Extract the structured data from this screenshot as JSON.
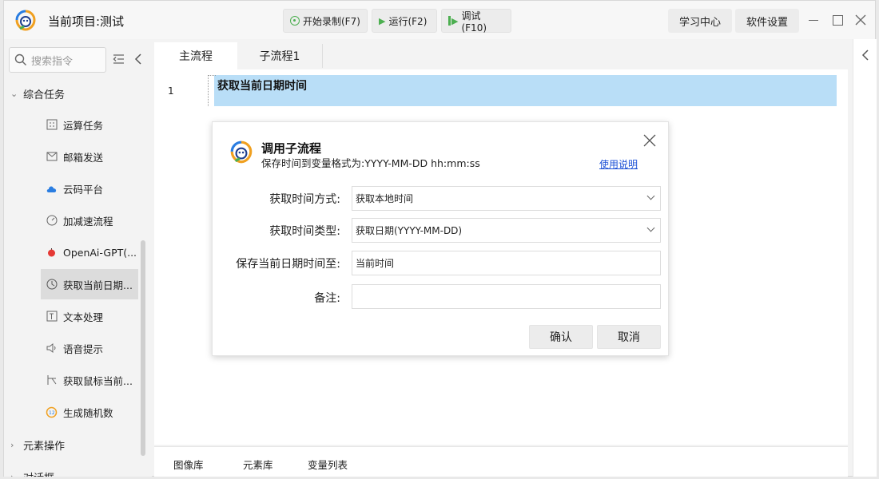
{
  "titlebar": {
    "project_title": "当前项目:测试",
    "buttons": {
      "record": "开始录制(F7)",
      "run": "运行(F2)",
      "debug": "调试(F10)"
    },
    "learning_center": "学习中心",
    "settings": "软件设置"
  },
  "sidebar": {
    "search_placeholder": "搜索指令",
    "section_general": "综合任务",
    "items": [
      {
        "label": "运算任务",
        "icon": "calculator-icon"
      },
      {
        "label": "邮箱发送",
        "icon": "mail-icon"
      },
      {
        "label": "云码平台",
        "icon": "cloud-icon"
      },
      {
        "label": "加减速流程",
        "icon": "speedometer-icon"
      },
      {
        "label": "OpenAi-GPT(...",
        "icon": "openai-icon"
      },
      {
        "label": "获取当前日期...",
        "icon": "clock-icon",
        "selected": true
      },
      {
        "label": "文本处理",
        "icon": "text-icon"
      },
      {
        "label": "语音提示",
        "icon": "speaker-icon"
      },
      {
        "label": "获取鼠标当前...",
        "icon": "cursor-icon"
      },
      {
        "label": "生成随机数",
        "icon": "random-icon"
      }
    ],
    "section_elements": "元素操作",
    "section_partial": "对话框"
  },
  "main": {
    "tabs": [
      "主流程",
      "子流程1"
    ],
    "line_number": "1",
    "code_line": "获取当前日期时间"
  },
  "bottom_tabs": [
    "图像库",
    "元素库",
    "变量列表"
  ],
  "dialog": {
    "title": "调用子流程",
    "subtitle": "保存时间到变量格式为:YYYY-MM-DD hh:mm:ss",
    "help": "使用说明",
    "fields": {
      "method_label": "获取时间方式:",
      "method_value": "获取本地时间",
      "type_label": "获取时间类型:",
      "type_value": "获取日期(YYYY-MM-DD)",
      "save_label": "保存当前日期时间至:",
      "save_value": "当前时间",
      "note_label": "备注:",
      "note_value": ""
    },
    "confirm": "确认",
    "cancel": "取消"
  },
  "colors": {
    "accent_green": "#4caf50",
    "highlight_blue": "#b9def7",
    "link_blue": "#1a4fd6"
  }
}
